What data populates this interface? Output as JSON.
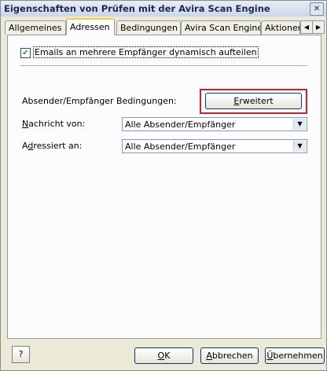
{
  "window": {
    "title": "Eigenschaften von Prüfen mit der Avira Scan Engine",
    "close_glyph": "✕"
  },
  "tabs": [
    {
      "label": "Allgemeines",
      "active": false
    },
    {
      "label": "Adressen",
      "active": true
    },
    {
      "label": "Bedingungen",
      "active": false
    },
    {
      "label": "Avira Scan Engine",
      "active": false
    },
    {
      "label": "Aktionen",
      "active": false
    }
  ],
  "tab_scroll": {
    "left": "◀",
    "right": "▶"
  },
  "addresses": {
    "split_checkbox": {
      "checked": true,
      "mark": "✔",
      "label": "Emails an mehrere Empfänger dynamisch aufteilen"
    },
    "conditions_label": "Absender/Empfänger Bedingungen:",
    "extended_button": {
      "accel": "E",
      "rest": "rweitert"
    },
    "message_from": {
      "label_accel": "N",
      "label_rest": "achricht von:",
      "value": "Alle Absender/Empfänger"
    },
    "addressed_to": {
      "label_pre": "A",
      "label_accel": "d",
      "label_rest": "ressiert an:",
      "value": "Alle Absender/Empfänger"
    }
  },
  "footer": {
    "help_icon": "?",
    "ok": {
      "accel": "O",
      "rest": "K"
    },
    "cancel": {
      "pre": "",
      "accel": "A",
      "rest": "bbrechen"
    },
    "apply": {
      "accel": "Ü",
      "rest": "bernehmen"
    }
  }
}
